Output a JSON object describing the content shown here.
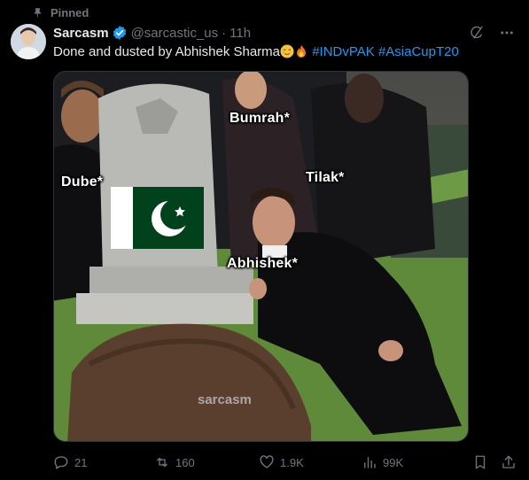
{
  "pinned_label": "Pinned",
  "author": {
    "name": "Sarcasm",
    "handle": "@sarcastic_us",
    "separator": "·",
    "time": "11h"
  },
  "tweet": {
    "text_before": "Done and dusted by Abhishek Sharma",
    "hashtags": [
      "#INDvPAK",
      "#AsiaCupT20"
    ]
  },
  "media": {
    "labels": {
      "bumrah": "Bumrah*",
      "tilak": "Tilak*",
      "dube": "Dube*",
      "abhishek": "Abhishek*"
    },
    "watermark": "sarcasm"
  },
  "actions": {
    "replies": "21",
    "reposts": "160",
    "likes": "1.9K",
    "views": "99K"
  },
  "colors": {
    "background": "#000000",
    "text": "#e7e9ea",
    "muted": "#71767b",
    "accent": "#1d9bf0"
  }
}
